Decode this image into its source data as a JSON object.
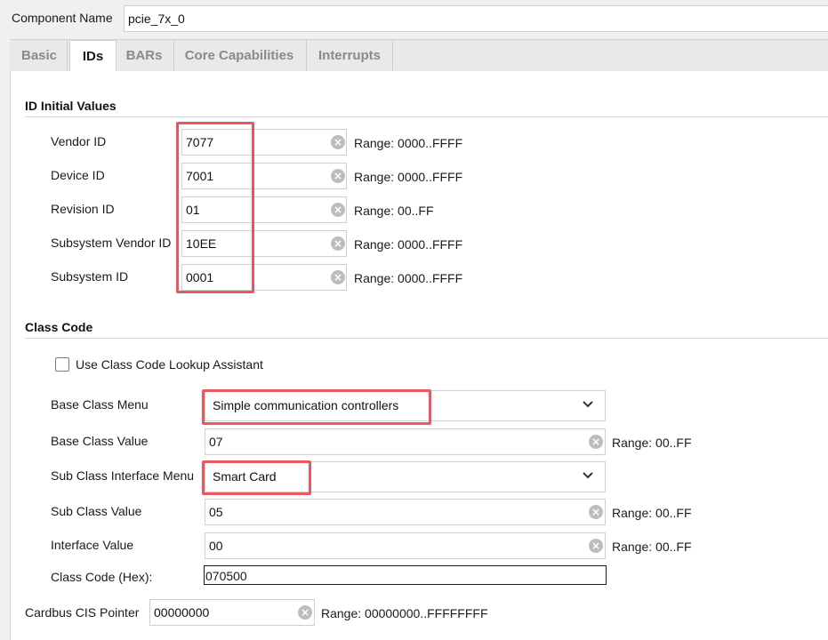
{
  "header": {
    "component_name_label": "Component Name",
    "component_name_value": "pcie_7x_0"
  },
  "tabs": [
    {
      "label": "Basic",
      "active": false
    },
    {
      "label": "IDs",
      "active": true
    },
    {
      "label": "BARs",
      "active": false
    },
    {
      "label": "Core Capabilities",
      "active": false
    },
    {
      "label": "Interrupts",
      "active": false
    }
  ],
  "id_section": {
    "title": "ID Initial Values",
    "fields": [
      {
        "label": "Vendor ID",
        "value": "7077",
        "range": "Range: 0000..FFFF"
      },
      {
        "label": "Device ID",
        "value": "7001",
        "range": "Range: 0000..FFFF"
      },
      {
        "label": "Revision ID",
        "value": "01",
        "range": "Range: 00..FF"
      },
      {
        "label": "Subsystem Vendor ID",
        "value": "10EE",
        "range": "Range: 0000..FFFF"
      },
      {
        "label": "Subsystem ID",
        "value": "0001",
        "range": "Range: 0000..FFFF"
      }
    ]
  },
  "class_section": {
    "title": "Class Code",
    "lookup_checkbox_label": "Use Class Code Lookup Assistant",
    "lookup_checked": false,
    "base_class_menu": {
      "label": "Base Class Menu",
      "value": "Simple communication controllers"
    },
    "base_class_value": {
      "label": "Base Class Value",
      "value": "07",
      "range": "Range: 00..FF"
    },
    "sub_class_interface_menu": {
      "label": "Sub Class Interface Menu",
      "value": "Smart Card"
    },
    "sub_class_value": {
      "label": "Sub Class Value",
      "value": "05",
      "range": "Range: 00..FF"
    },
    "interface_value": {
      "label": "Interface Value",
      "value": "00",
      "range": "Range: 00..FF"
    },
    "class_code_hex": {
      "label": "Class Code (Hex):",
      "value": "070500"
    }
  },
  "cardbus": {
    "label": "Cardbus CIS Pointer",
    "value": "00000000",
    "range": "Range: 00000000..FFFFFFFF"
  },
  "icons": {
    "clear": "clear-circle-x-icon",
    "dropdown": "chevron-down-icon"
  },
  "colors": {
    "highlight": "#e8585c",
    "panel": "#ffffff",
    "background": "#f0f0f0"
  }
}
